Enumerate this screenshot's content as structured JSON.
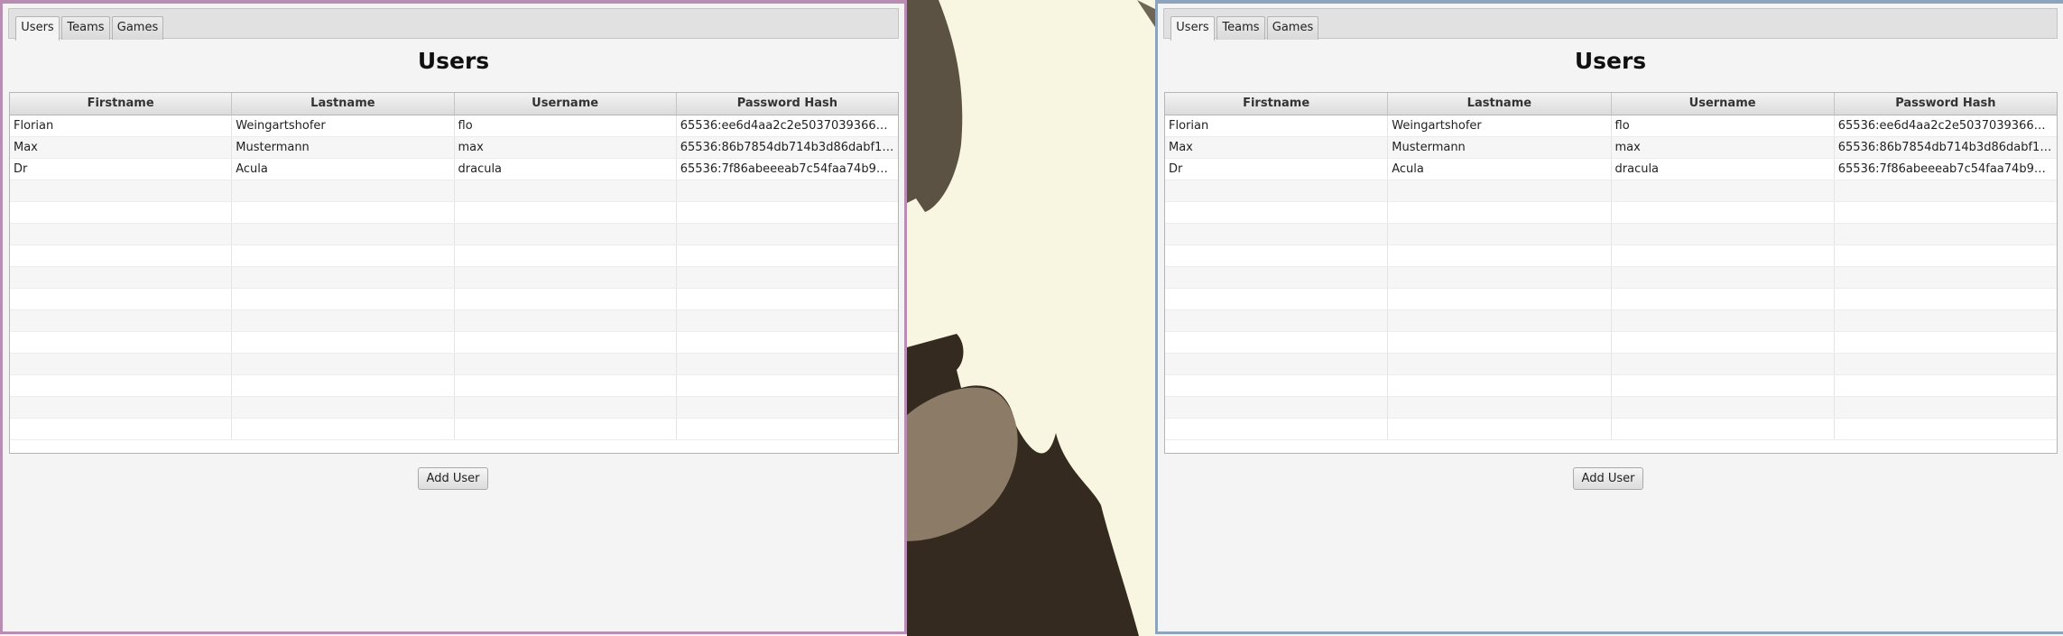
{
  "tabs": [
    "Users",
    "Teams",
    "Games"
  ],
  "page_title": "Users",
  "columns": [
    "Firstname",
    "Lastname",
    "Username",
    "Password Hash"
  ],
  "rows": [
    [
      "Florian",
      "Weingartshofer",
      "flo",
      "65536:ee6d4aa2c2e5037039366…"
    ],
    [
      "Max",
      "Mustermann",
      "max",
      "65536:86b7854db714b3d86dabf1…"
    ],
    [
      "Dr",
      "Acula",
      "dracula",
      "65536:7f86abeeeab7c54faa74b9…"
    ]
  ],
  "empty_row_count": 12,
  "add_button_label": "Add User",
  "colors": {
    "left_window_border": "#b98db1",
    "right_window_border": "#8da4bf",
    "wallpaper": "#f8f6e0"
  }
}
